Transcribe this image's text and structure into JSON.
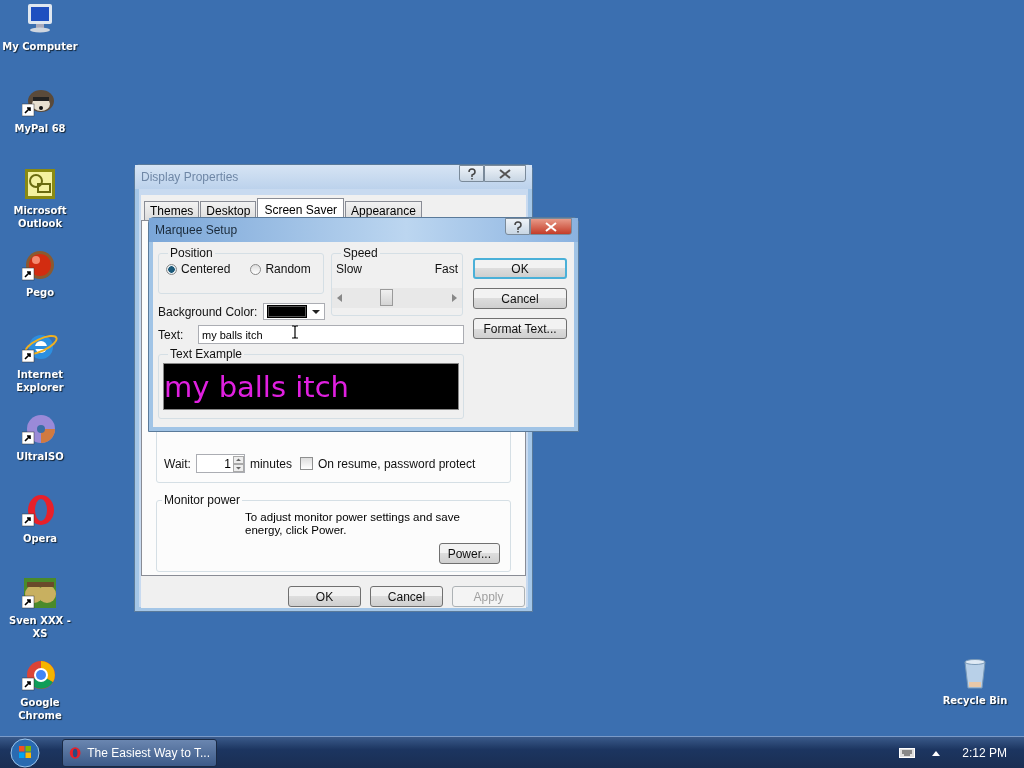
{
  "desktop_icons": [
    {
      "label": "My Computer",
      "shortcut": false
    },
    {
      "label": "MyPal 68",
      "shortcut": true
    },
    {
      "label": "Microsoft Outlook",
      "shortcut": false
    },
    {
      "label": "Pego",
      "shortcut": true
    },
    {
      "label": "Internet Explorer",
      "shortcut": true
    },
    {
      "label": "UltraISO",
      "shortcut": true
    },
    {
      "label": "Opera",
      "shortcut": true
    },
    {
      "label": "Sven XXX - XS",
      "shortcut": true
    },
    {
      "label": "Google Chrome",
      "shortcut": true
    }
  ],
  "recycle_bin": {
    "label": "Recycle Bin"
  },
  "display_properties": {
    "title": "Display Properties",
    "tabs": [
      {
        "label": "Themes",
        "selected": false
      },
      {
        "label": "Desktop",
        "selected": false
      },
      {
        "label": "Screen Saver",
        "selected": true
      },
      {
        "label": "Appearance",
        "selected": false
      }
    ],
    "wait": {
      "label": "Wait:",
      "value": "1",
      "unit": "minutes"
    },
    "password_protect": {
      "label": "On resume, password protect",
      "checked": false
    },
    "monitor_power": {
      "title": "Monitor power",
      "text": "To adjust monitor power settings and save energy, click Power.",
      "button": "Power..."
    },
    "buttons": [
      {
        "label": "OK",
        "disabled": false
      },
      {
        "label": "Cancel",
        "disabled": false
      },
      {
        "label": "Apply",
        "disabled": true
      }
    ]
  },
  "marquee_setup": {
    "title": "Marquee Setup",
    "position": {
      "title": "Position",
      "options": [
        {
          "label": "Centered",
          "selected": true
        },
        {
          "label": "Random",
          "selected": false
        }
      ]
    },
    "speed": {
      "title": "Speed",
      "min_label": "Slow",
      "max_label": "Fast",
      "level": 0.4
    },
    "background_color": {
      "label": "Background Color:",
      "color": "#000000"
    },
    "text": {
      "label": "Text:",
      "value": "my balls itch"
    },
    "text_example": {
      "title": "Text Example",
      "sample": "my balls itch"
    },
    "buttons": [
      {
        "label": "OK",
        "default": true
      },
      {
        "label": "Cancel",
        "default": false
      },
      {
        "label": "Format Text...",
        "default": false
      }
    ]
  },
  "taskbar": {
    "task": "The Easiest Way to T...",
    "clock": "2:12 PM"
  }
}
